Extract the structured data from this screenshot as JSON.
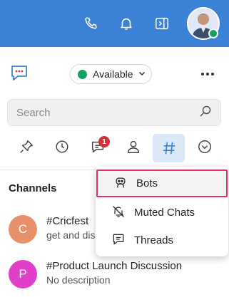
{
  "colors": {
    "accent": "#3b82d6",
    "presence": "#13a15e",
    "badge": "#d4323a",
    "highlight": "#e0306a"
  },
  "topbar": {
    "icons": [
      "phone-icon",
      "bell-icon",
      "collapse-panel-icon"
    ]
  },
  "status": {
    "label": "Available"
  },
  "search": {
    "placeholder": "Search"
  },
  "filters": {
    "unread_badge": "1"
  },
  "section": {
    "title": "Channels"
  },
  "channels": [
    {
      "initial": "C",
      "color": "#e8906b",
      "title": "#Cricfest",
      "subtitle": "get and dis"
    },
    {
      "initial": "P",
      "color": "#e040c8",
      "title": "#Product Launch Discussion",
      "subtitle": "No description"
    }
  ],
  "menu": {
    "items": [
      {
        "label": "Bots"
      },
      {
        "label": "Muted Chats"
      },
      {
        "label": "Threads"
      }
    ]
  }
}
